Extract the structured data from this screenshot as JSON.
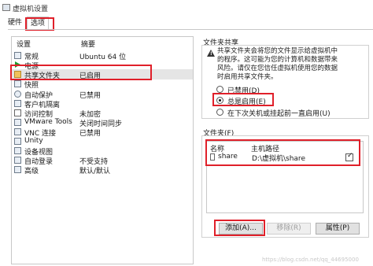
{
  "window": {
    "title": "虚拟机设置"
  },
  "tabs": [
    {
      "label": "硬件"
    },
    {
      "label": "选项"
    }
  ],
  "list": {
    "col_setting": "设置",
    "col_summary": "摘要",
    "rows": [
      {
        "icon": "os-icon",
        "name": "常规",
        "summary": "Ubuntu 64 位"
      },
      {
        "icon": "power-icon",
        "name": "电源",
        "summary": ""
      },
      {
        "icon": "shared-folder-icon",
        "name": "共享文件夹",
        "summary": "已启用"
      },
      {
        "icon": "snapshot-icon",
        "name": "快照",
        "summary": ""
      },
      {
        "icon": "autoprotect-icon",
        "name": "自动保护",
        "summary": "已禁用"
      },
      {
        "icon": "guest-isolation-icon",
        "name": "客户机隔离",
        "summary": ""
      },
      {
        "icon": "access-control-icon",
        "name": "访问控制",
        "summary": "未加密"
      },
      {
        "icon": "vmware-tools-icon",
        "name": "VMware Tools",
        "summary": "关闭时间同步"
      },
      {
        "icon": "vnc-icon",
        "name": "VNC 连接",
        "summary": "已禁用"
      },
      {
        "icon": "unity-icon",
        "name": "Unity",
        "summary": ""
      },
      {
        "icon": "device-view-icon",
        "name": "设备视图",
        "summary": ""
      },
      {
        "icon": "autologin-icon",
        "name": "自动登录",
        "summary": "不受支持"
      },
      {
        "icon": "advanced-icon",
        "name": "高级",
        "summary": "默认/默认"
      }
    ]
  },
  "sharing": {
    "title": "文件夹共享",
    "warning": [
      "共享文件夹会将您的文件显示给虚拟机中",
      "的程序。这可能为您的计算机和数据带来",
      "风险。请仅在您信任虚拟机使用您的数据",
      "时启用共享文件夹。"
    ],
    "options": [
      {
        "label": "已禁用(D)",
        "selected": false
      },
      {
        "label": "总是启用(E)",
        "selected": true
      },
      {
        "label": "在下次关机或挂起前一直启用(U)",
        "selected": false
      }
    ]
  },
  "folders": {
    "title": "文件夹(F)",
    "col_name": "名称",
    "col_path": "主机路径",
    "rows": [
      {
        "name": "share",
        "path": "D:\\虚拟机\\share",
        "checked": true
      }
    ],
    "buttons": {
      "add": "添加(A)...",
      "remove": "移除(R)",
      "properties": "属性(P)"
    }
  },
  "watermark": "https://blog.csdn.net/qq_44695000"
}
